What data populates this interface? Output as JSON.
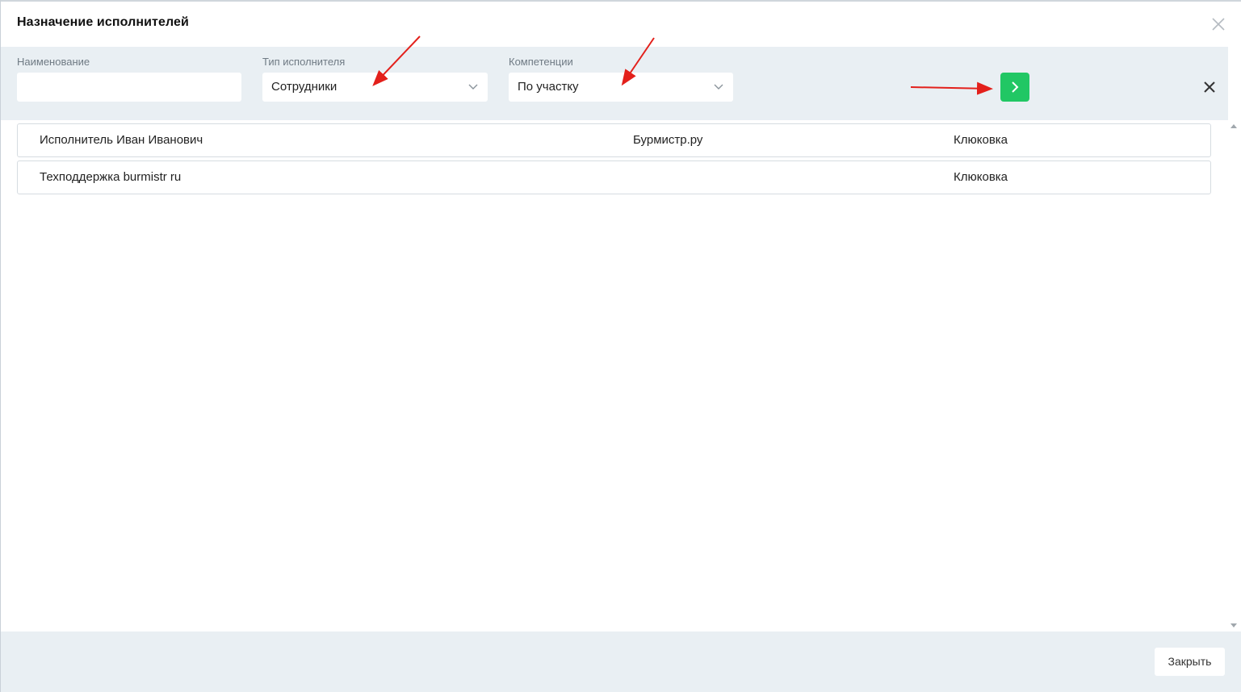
{
  "modal": {
    "title": "Назначение исполнителей"
  },
  "filters": {
    "name": {
      "label": "Наименование",
      "value": ""
    },
    "executor_type": {
      "label": "Тип исполнителя",
      "value": "Сотрудники"
    },
    "competencies": {
      "label": "Компетенции",
      "value": "По участку"
    }
  },
  "rows": [
    {
      "name": "Исполнитель Иван Иванович",
      "company": "Бурмистр.ру",
      "location": "Клюковка"
    },
    {
      "name": "Техподдержка burmistr ru",
      "company": "",
      "location": "Клюковка"
    }
  ],
  "footer": {
    "close_label": "Закрыть"
  },
  "colors": {
    "accent": "#21c764",
    "annotation_arrow": "#e3201b",
    "panel": "#e9eff3"
  },
  "icons": {
    "modal_close": "close-icon",
    "dropdown": "chevron-down-icon",
    "apply": "chevron-right-icon",
    "clear": "close-icon"
  }
}
